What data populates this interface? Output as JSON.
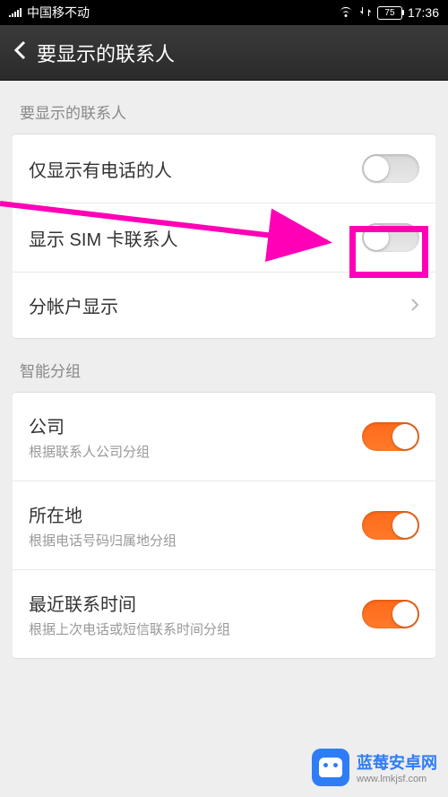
{
  "status_bar": {
    "carrier": "中国移不动",
    "battery": "75",
    "time": "17:36"
  },
  "header": {
    "title": "要显示的联系人"
  },
  "sections": {
    "display": {
      "header": "要显示的联系人",
      "items": {
        "phone_only": {
          "title": "仅显示有电话的人",
          "on": false
        },
        "sim": {
          "title": "显示 SIM 卡联系人",
          "on": false
        },
        "by_account": {
          "title": "分帐户显示"
        }
      }
    },
    "smart_group": {
      "header": "智能分组",
      "items": {
        "company": {
          "title": "公司",
          "subtitle": "根据联系人公司分组",
          "on": true
        },
        "location": {
          "title": "所在地",
          "subtitle": "根据电话号码归属地分组",
          "on": true
        },
        "recent": {
          "title": "最近联系时间",
          "subtitle": "根据上次电话或短信联系时间分组",
          "on": true
        }
      }
    }
  },
  "watermark": {
    "title": "蓝莓安卓网",
    "url": "www.lmkjsf.com"
  }
}
